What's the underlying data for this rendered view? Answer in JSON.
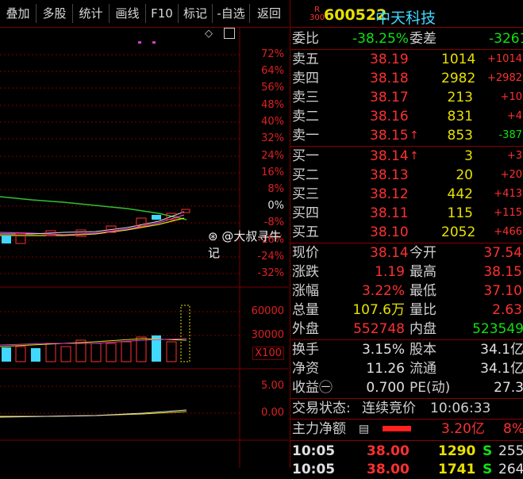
{
  "tabs": [
    "叠加",
    "多股",
    "统计",
    "画线",
    "F10",
    "标记",
    "-自选",
    "返回"
  ],
  "stock": {
    "badge_r": "R",
    "badge_num": "300",
    "code": "600522",
    "name": "中天科技"
  },
  "chart": {
    "pct_labels": [
      "72%",
      "64%",
      "56%",
      "48%",
      "40%",
      "32%",
      "24%",
      "16%",
      "8%",
      "0%",
      "-8%",
      "-16%",
      "-24%",
      "-32%"
    ],
    "vol_labels": [
      "60000",
      "30000",
      "X100"
    ],
    "ind_labels": [
      "5.00",
      "0.00"
    ]
  },
  "watermark": "@大叔寻牛记",
  "weibi": {
    "label1": "委比",
    "value1": "-38.25%",
    "label2": "委差",
    "value2": "-3261"
  },
  "sells": [
    {
      "label": "卖五",
      "price": "38.19",
      "vol": "1014",
      "chg": "+1014"
    },
    {
      "label": "卖四",
      "price": "38.18",
      "vol": "2982",
      "chg": "+2982"
    },
    {
      "label": "卖三",
      "price": "38.17",
      "vol": "213",
      "chg": "+10"
    },
    {
      "label": "卖二",
      "price": "38.16",
      "vol": "831",
      "chg": "+4"
    },
    {
      "label": "卖一",
      "price": "38.15",
      "arrow": "↑",
      "vol": "853",
      "chg": "-387"
    }
  ],
  "buys": [
    {
      "label": "买一",
      "price": "38.14",
      "arrow": "↑",
      "vol": "3",
      "chg": "+3"
    },
    {
      "label": "买二",
      "price": "38.13",
      "vol": "20",
      "chg": "+20"
    },
    {
      "label": "买三",
      "price": "38.12",
      "vol": "442",
      "chg": "+413"
    },
    {
      "label": "买四",
      "price": "38.11",
      "vol": "115",
      "chg": "+115"
    },
    {
      "label": "买五",
      "price": "38.10",
      "vol": "2052",
      "chg": "+466"
    }
  ],
  "quote": [
    {
      "l1": "现价",
      "v1": "38.14",
      "l2": "今开",
      "v2": "37.54"
    },
    {
      "l1": "涨跌",
      "v1": "1.19",
      "l2": "最高",
      "v2": "38.15"
    },
    {
      "l1": "涨幅",
      "v1": "3.22%",
      "l2": "最低",
      "v2": "37.10"
    },
    {
      "l1": "总量",
      "v1": "107.6万",
      "l2": "量比",
      "v2": "2.63"
    },
    {
      "l1": "外盘",
      "v1": "552748",
      "l2": "内盘",
      "v2": "523549"
    }
  ],
  "fund": [
    {
      "l1": "换手",
      "v1": "3.15%",
      "l2": "股本",
      "v2": "34.1亿"
    },
    {
      "l1": "净资",
      "v1": "11.26",
      "l2": "流通",
      "v2": "34.1亿"
    },
    {
      "l1": "收益㊀",
      "v1": "0.700",
      "l2": "PE(动)",
      "v2": "27.3"
    }
  ],
  "status": {
    "label": "交易状态:",
    "value": "连续竞价",
    "time": "10:06:33"
  },
  "mainflow": {
    "label": "主力净额",
    "value": "3.20亿",
    "pct": "8%"
  },
  "ticks": [
    {
      "time": "10:05",
      "price": "38.00",
      "vol": "1290",
      "side": "S",
      "num": "255"
    },
    {
      "time": "10:05",
      "price": "38.00",
      "vol": "1741",
      "side": "S",
      "num": "264"
    }
  ],
  "colors": {
    "up": "#ff3030",
    "down": "#10e010",
    "grid": "#7a0000",
    "accent": "#e8e000"
  }
}
